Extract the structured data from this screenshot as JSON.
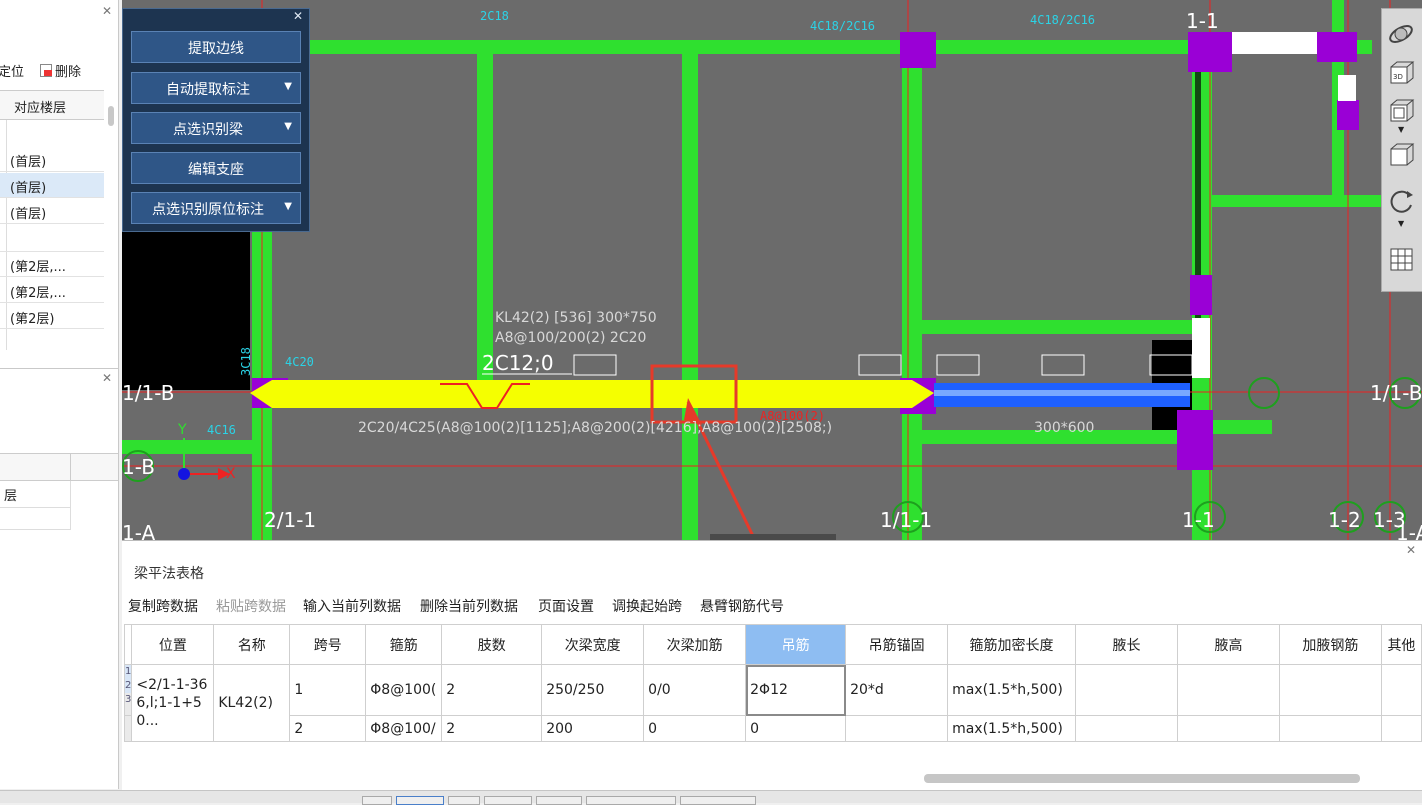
{
  "left_top": {
    "toolbar": {
      "locate_label": "定位",
      "delete_label": "删除"
    },
    "column_header": "对应楼层",
    "floor_rows": [
      "(首层)",
      "(首层)",
      "(首层)",
      "(第2层,...",
      "(第2层,...",
      "(第2层)"
    ]
  },
  "left_bottom": {
    "row_label": "层"
  },
  "float_menu": {
    "items": [
      {
        "label": "提取边线"
      },
      {
        "label": "自动提取标注"
      },
      {
        "label": "点选识别梁"
      },
      {
        "label": "编辑支座"
      },
      {
        "label": "点选识别原位标注"
      }
    ]
  },
  "canvas": {
    "axis_labels": [
      "1/1-B",
      "1/1-B",
      "1-B",
      "1-A",
      "2/1-1",
      "1/1-1",
      "1-1",
      "1-1",
      "1-2",
      "1-3",
      "1-A"
    ],
    "texts": {
      "top_2c18": "2C18",
      "top_4c18_a": "4C18/2C16",
      "top_4c18_b": "4C18/2C16",
      "beam_label_1": "KL42(2) [536] 300*750",
      "beam_label_2": "A8@100/200(2) 2C20",
      "beam_anno": "2C12;0",
      "left_4c20": "4C20",
      "left_3c18": "3C18",
      "left_4c16": "4C16",
      "side_anno": "2C20/4C25(A8@100(2)[1125];A8@200(2)[4216];A8@100(2)[2508;)",
      "small_anno": "A8@100(2)",
      "dim_300x600": "300*600",
      "axis_y": "Y",
      "axis_x": "X"
    },
    "colors": {
      "background": "#6b6b6b",
      "wall": "#2fe02f",
      "beam_selected": "#f5ff00",
      "column": "#9a00d6",
      "beam_blue": "#1e60ff",
      "highlight": "#e63a2a"
    }
  },
  "bottom": {
    "title": "梁平法表格",
    "toolbar": [
      {
        "label": "复制跨数据",
        "enabled": true
      },
      {
        "label": "粘贴跨数据",
        "enabled": false
      },
      {
        "label": "输入当前列数据",
        "enabled": true
      },
      {
        "label": "删除当前列数据",
        "enabled": true
      },
      {
        "label": "页面设置",
        "enabled": true
      },
      {
        "label": "调换起始跨",
        "enabled": true
      },
      {
        "label": "悬臂钢筋代号",
        "enabled": true
      }
    ],
    "headers": [
      "位置",
      "名称",
      "跨号",
      "箍筋",
      "肢数",
      "次梁宽度",
      "次梁加筋",
      "吊筋",
      "吊筋锚固",
      "箍筋加密长度",
      "腋长",
      "腋高",
      "加腋钢筋",
      "其他"
    ],
    "active_header": "吊筋",
    "row_numbers": [
      "1",
      "2",
      "3"
    ],
    "position_value": "<2/1-1-366,l;1-1+50...",
    "name_value": "KL42(2)",
    "rows": [
      {
        "span": "1",
        "stirrup": "Φ8@100(",
        "legs": "2",
        "sub_width": "250/250",
        "sub_add": "0/0",
        "hanger": "2Φ12",
        "anchor": "20*d",
        "dense_len": "max(1.5*h,500)"
      },
      {
        "span": "2",
        "stirrup": "Φ8@100/",
        "legs": "2",
        "sub_width": "200",
        "sub_add": "0",
        "hanger": "0",
        "anchor": "",
        "dense_len": "max(1.5*h,500)"
      }
    ]
  }
}
